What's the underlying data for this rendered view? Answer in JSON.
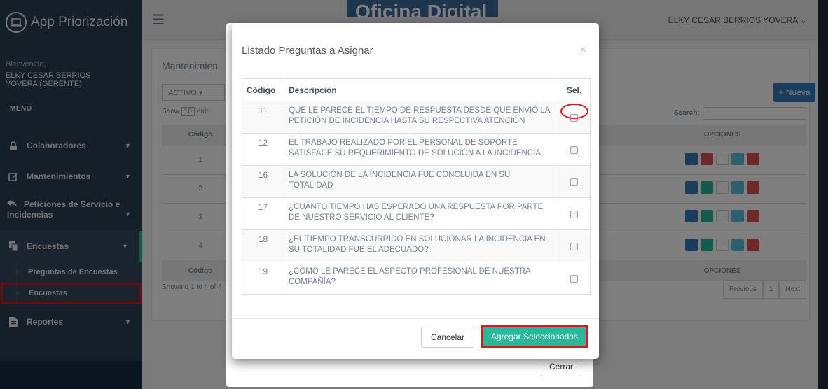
{
  "brand": {
    "title": "App Priorización",
    "icon": "laptop-icon"
  },
  "sidebar": {
    "welcome": "Bienvenido,",
    "user": "ELKY CESAR BERRIOS YOVERA (GERENTE)",
    "menu_title": "MENÚ",
    "items": [
      {
        "label": "Colaboradores",
        "icon": "lock-icon"
      },
      {
        "label": "Mantenimientos",
        "icon": "edit-icon"
      },
      {
        "label": "Peticiones de Servicio e Incidencias",
        "icon": "reply-icon"
      },
      {
        "label": "Encuestas",
        "icon": "copy-icon"
      },
      {
        "label": "Reportes",
        "icon": "file-icon"
      }
    ],
    "submenu": [
      {
        "label": "Preguntas de Encuestas"
      },
      {
        "label": "Encuestas"
      }
    ]
  },
  "topbar": {
    "user_menu": "ELKY CESAR BERRIOS YOVERA",
    "logo_text": "Oficina Digital"
  },
  "background_page": {
    "title": "Mantenimien",
    "status_select": "ACTIVO",
    "new_button": "Nueva",
    "show_entries_prefix": "Show",
    "show_entries_value": "10",
    "show_entries_suffix": "entr",
    "search_label": "Search:",
    "col_code": "Código",
    "col_options": "OPCIONES",
    "rows": [
      "1",
      "2",
      "3",
      "4"
    ],
    "showing": "Showing 1 to 4 of 4",
    "pager": [
      "Previous",
      "1",
      "Next"
    ],
    "close_button": "Cerrar"
  },
  "modal": {
    "title": "Listado Preguntas a Asignar",
    "close": "×",
    "headers": {
      "code": "Código",
      "description": "Descripción",
      "select": "Sel."
    },
    "rows": [
      {
        "code": "11",
        "description": "QUE LE PARECE EL TIEMPO DE RESPUESTA DESDE QUE ENVIÓ LA PETICIÓN DE INCIDENCIA HASTA SU RESPECTIVA ATENCIÓN",
        "checked": false
      },
      {
        "code": "12",
        "description": "EL TRABAJO REALIZADO POR EL PERSONAL DE SOPORTE SATISFACE SU REQUERIMIENTO DE SOLUCIÓN A LA INCIDENCIA",
        "checked": false
      },
      {
        "code": "16",
        "description": "LA SOLUCIÓN DE LA INCIDENCIA FUE CONCLUIDA EN SU TOTALIDAD",
        "checked": false
      },
      {
        "code": "17",
        "description": "¿CUÁNTO TIEMPO HAS ESPERADO UNA RESPUESTA POR PARTE DE NUESTRO SERVICIO AL CLIENTE?",
        "checked": false
      },
      {
        "code": "18",
        "description": "¿EL TIEMPO TRANSCURRIDO EN SOLUCIONAR LA INCIDENCIA EN SU TOTALIDAD FUE EL ADECUADO?",
        "checked": false
      },
      {
        "code": "19",
        "description": "¿CÓMO LE PARECE EL ASPECTO PROFESIONAL DE NUESTRA COMPAÑÍA?",
        "checked": false
      }
    ],
    "cancel_button": "Cancelar",
    "add_button": "Agregar Seleccionadas"
  },
  "colors": {
    "sidebar": "#2a3f54",
    "accent": "#26b99a",
    "highlight": "#e0161b"
  }
}
